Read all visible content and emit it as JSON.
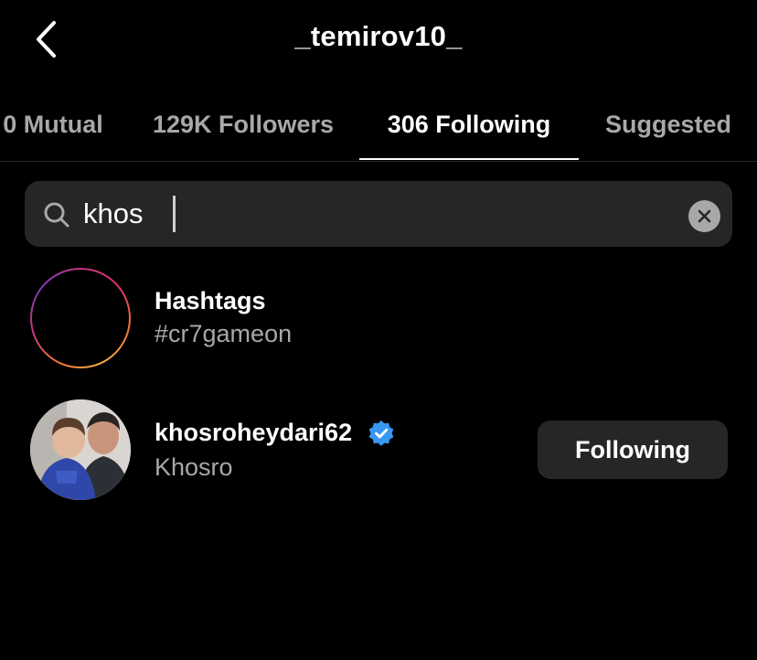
{
  "header": {
    "title": "_temirov10_"
  },
  "tabs": [
    {
      "label": "0 Mutual",
      "active": false
    },
    {
      "label": "129K Followers",
      "active": false
    },
    {
      "label": "306 Following",
      "active": true
    },
    {
      "label": "Suggested",
      "active": false
    }
  ],
  "search": {
    "value": "khos",
    "icon": "search-icon",
    "clear_icon": "clear-icon"
  },
  "results": [
    {
      "type": "hashtag",
      "title": "Hashtags",
      "subtitle": "#cr7gameon",
      "icon": "hashtag-icon"
    },
    {
      "type": "user",
      "username": "khosroheydari62",
      "name": "Khosro",
      "verified": true,
      "button_label": "Following"
    }
  ],
  "colors": {
    "background": "#000000",
    "text_primary": "#ffffff",
    "text_secondary": "#a8a8a8",
    "surface": "#262626",
    "verified_blue": "#3897f0"
  }
}
